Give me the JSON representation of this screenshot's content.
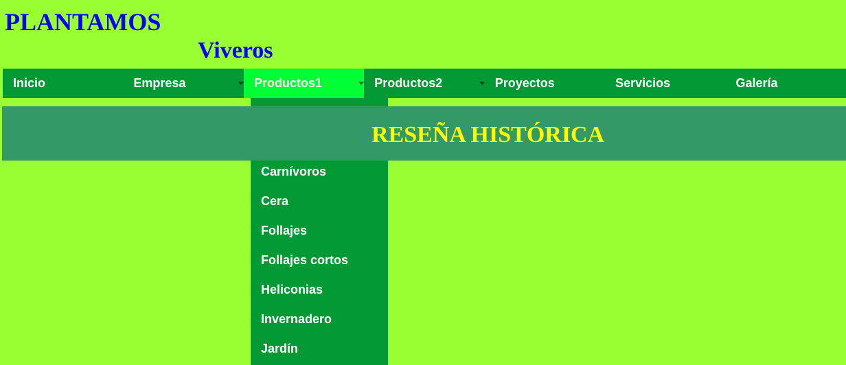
{
  "header": {
    "title": "PLANTAMOS",
    "subtitle": "Viveros"
  },
  "nav": {
    "items": [
      {
        "label": "Inicio"
      },
      {
        "label": "Empresa"
      },
      {
        "label": "Productos1"
      },
      {
        "label": "Productos2"
      },
      {
        "label": "Proyectos"
      },
      {
        "label": "Servicios"
      },
      {
        "label": "Galería"
      }
    ],
    "active": "Productos1"
  },
  "dropdown": {
    "items": [
      {
        "label": "Carnívoros"
      },
      {
        "label": "Cera"
      },
      {
        "label": "Follajes"
      },
      {
        "label": "Follajes cortos"
      },
      {
        "label": "Heliconias"
      },
      {
        "label": "Invernadero"
      },
      {
        "label": "Jardín"
      }
    ]
  },
  "banner": {
    "title": "RESEÑA HISTÓRICA"
  },
  "colors": {
    "background": "#99ff33",
    "nav_background": "#009933",
    "nav_active": "#00ff33",
    "banner_background": "#339966",
    "banner_text": "#ffff00",
    "brand_text": "#0000ff"
  },
  "icons": {
    "dropdown_indicator": "caret-down-icon"
  }
}
